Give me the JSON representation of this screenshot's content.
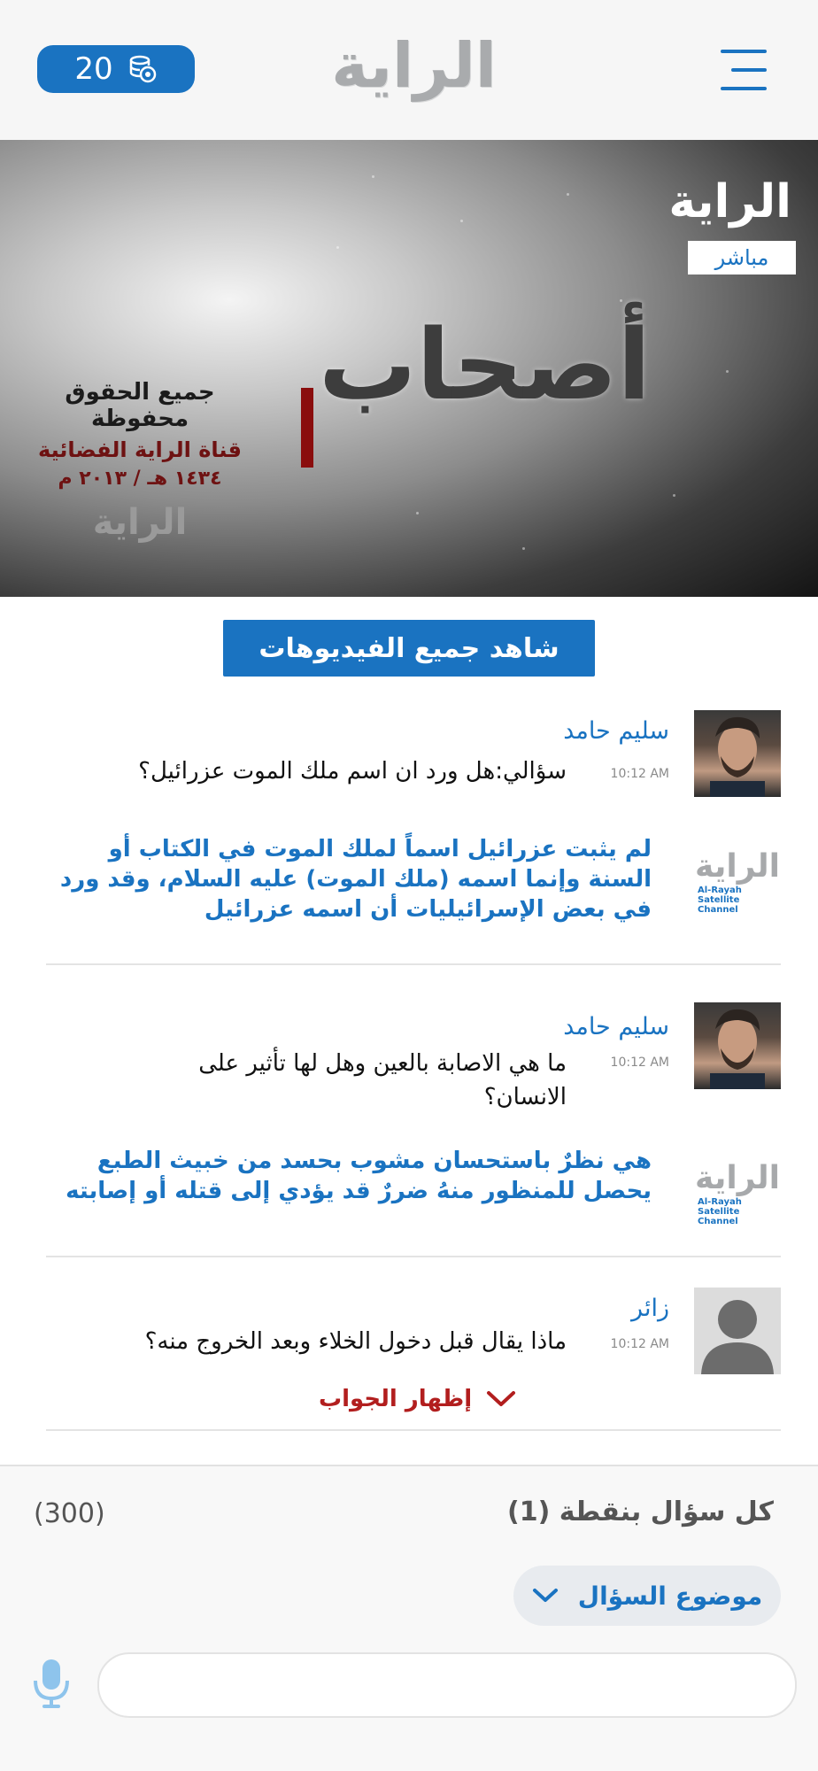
{
  "header": {
    "coins": "20",
    "logo": "الراية"
  },
  "video": {
    "channel_logo": "الراية",
    "live_badge": "مباشر",
    "title_overlay": "أصحاب",
    "copyright_line1": "جميع الحقوق محفوظة",
    "copyright_line2": "قناة الراية الفضائية",
    "copyright_line3": "١٤٣٤ هـ / ٢٠١٣ م",
    "copyright_logo": "الراية"
  },
  "watch_all_label": "شاهد جميع الفيديوهات",
  "answer_logo": {
    "name": "الراية",
    "caption": "Al-Rayah Satellite Channel"
  },
  "qa": [
    {
      "asker": "سليم حامد",
      "time": "10:12 AM",
      "question": "سؤالي:هل ورد ان اسم ملك الموت عزرائيل؟",
      "answer": "لم يثبت عزرائيل اسماً لملك الموت في الكتاب أو السنة وإنما اسمه (ملك الموت) عليه السلام، وقد ورد في بعض الإسرائيليات أن اسمه عزرائيل"
    },
    {
      "asker": "سليم حامد",
      "time": "10:12 AM",
      "question": "ما هي الاصابة بالعين وهل لها تأثير على الانسان؟",
      "answer": "هي نظرٌ باستحسان مشوب بحسد من خبيث الطبع يحصل للمنظور منهُ ضررٌ قد يؤدي إلى قتله أو إصابته"
    },
    {
      "asker": "زائر",
      "time": "10:12 AM",
      "question": "ماذا يقال قبل دخول الخلاء وبعد الخروج منه؟",
      "show_answer": "إظهار الجواب"
    }
  ],
  "compose": {
    "cost_text": "كل سؤال بنقطة (1)",
    "char_count": "(300)",
    "topic_label": "موضوع السؤال",
    "placeholder": ""
  },
  "colors": {
    "accent": "#1a73c1",
    "show_answer": "#b21e1e"
  }
}
